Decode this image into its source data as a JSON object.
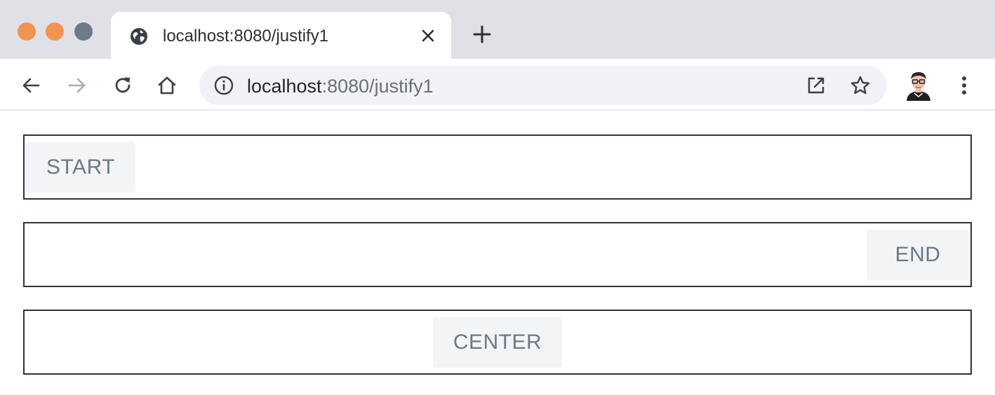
{
  "window": {
    "traffic_lights": {
      "close_color": "#f2944f",
      "minimize_color": "#f2944f",
      "maximize_color": "#6e7a88"
    }
  },
  "tab": {
    "title": "localhost:8080/justify1",
    "icon": "globe-icon"
  },
  "toolbar": {
    "back_icon": "arrow-left-icon",
    "forward_icon": "arrow-right-icon",
    "reload_icon": "reload-icon",
    "home_icon": "home-icon",
    "menu_icon": "kebab-menu-icon"
  },
  "omnibox": {
    "url_host": "localhost",
    "url_rest": ":8080/justify1",
    "info_icon": "info-icon",
    "share_icon": "open-external-icon",
    "bookmark_icon": "star-icon"
  },
  "page": {
    "buttons": [
      {
        "label": "START",
        "justify": "start"
      },
      {
        "label": "END",
        "justify": "end"
      },
      {
        "label": "CENTER",
        "justify": "center"
      }
    ]
  },
  "colors": {
    "row_border": "#2b3442",
    "button_bg": "#f3f4f5",
    "button_text": "#6b7889",
    "tabstrip_bg": "#dfe1e6",
    "omnibox_bg": "#f0f2f5"
  }
}
